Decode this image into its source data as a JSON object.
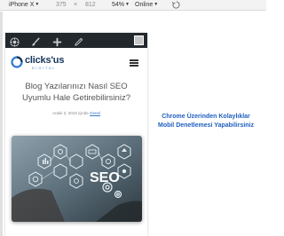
{
  "toolbar": {
    "device": "iPhone X",
    "width": "375",
    "separator": "×",
    "height": "812",
    "zoom": "54%",
    "network": "Online"
  },
  "adminbar": {
    "icons": [
      "wordpress-icon",
      "customize-icon",
      "new-content-icon",
      "edit-icon"
    ],
    "avatar": "avatar"
  },
  "site": {
    "logo_main": "clicks'us",
    "logo_sub": "DIGITAL"
  },
  "post": {
    "title": "Blog Yazılarınızı Nasıl SEO Uyumlu Hale Getirebilirsiniz?",
    "date": "Aralık 2, 2019",
    "in": "içinde",
    "category": "Genel",
    "image_text": "SEO"
  },
  "note": {
    "text": "Chrome Üzerinden Kolaylıklar Mobil Denetlemesi Yapabilirsiniz"
  }
}
